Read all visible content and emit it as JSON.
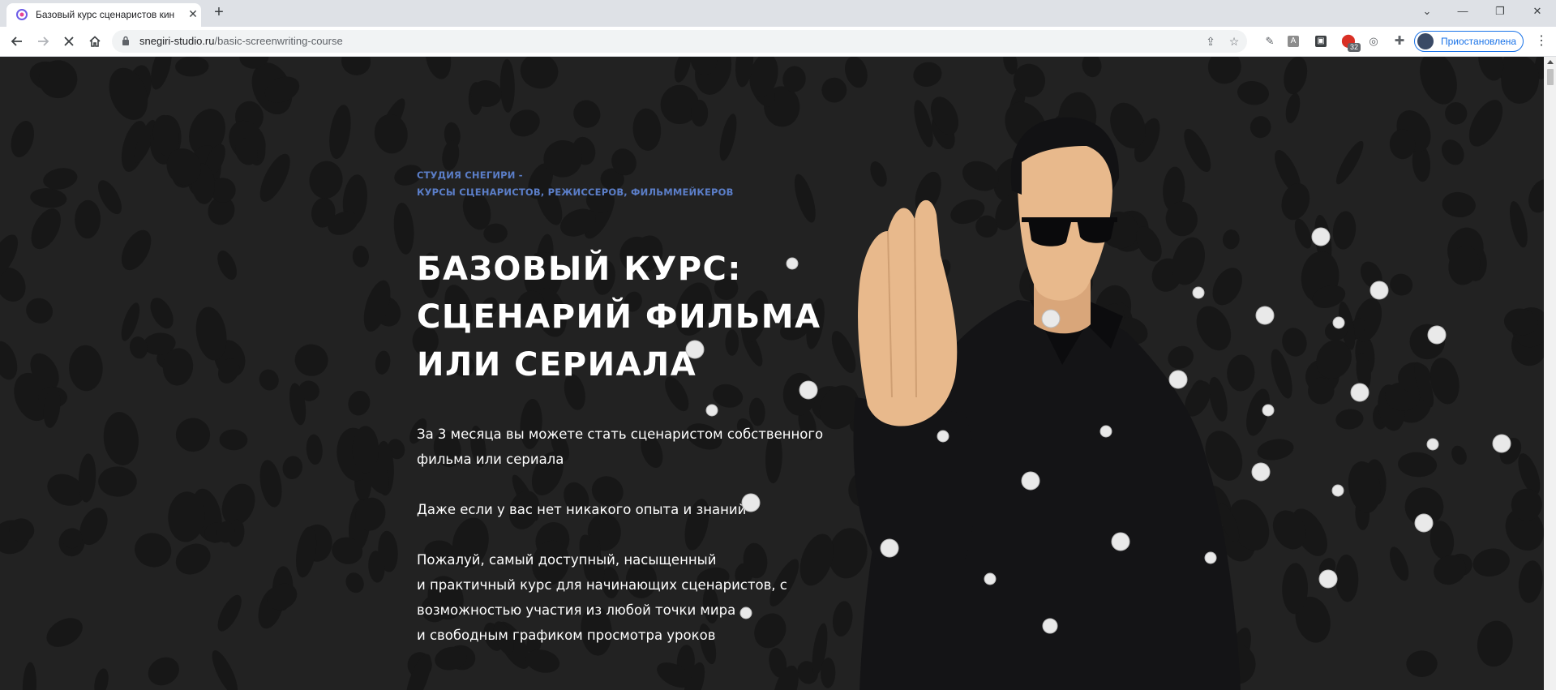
{
  "browser": {
    "tab_title": "Базовый курс сценаристов кин",
    "url_domain": "snegiri-studio.ru",
    "url_path": "/basic-screenwriting-course",
    "extension_badge": "32",
    "profile_label": "Приостановлена"
  },
  "hero": {
    "tagline_line1": "СТУДИЯ СНЕГИРИ -",
    "tagline_line2": "КУРСЫ СЦЕНАРИСТОВ, РЕЖИССЕРОВ, ФИЛЬММЕЙКЕРОВ",
    "title_line1": "БАЗОВЫЙ КУРС:",
    "title_line2": "СЦЕНАРИЙ ФИЛЬМА",
    "title_line3": "ИЛИ СЕРИАЛА",
    "p1_line1": "За 3 месяца вы можете стать сценаристом собственного",
    "p1_line2": "фильма или сериала",
    "p2": "Даже если у вас нет никакого опыта и знаний",
    "p3_line1": "Пожалуй, самый доступный, насыщенный",
    "p3_line2": "и практичный курс для начинающих сценаристов, с",
    "p3_line3": "возможностью участия из любой точки мира",
    "p3_line4": "и свободным графиком просмотра уроков"
  },
  "colors": {
    "background": "#222222",
    "accent": "#5b7ec8",
    "text": "#ffffff",
    "skin": "#e8b98c",
    "coat": "#141416"
  }
}
